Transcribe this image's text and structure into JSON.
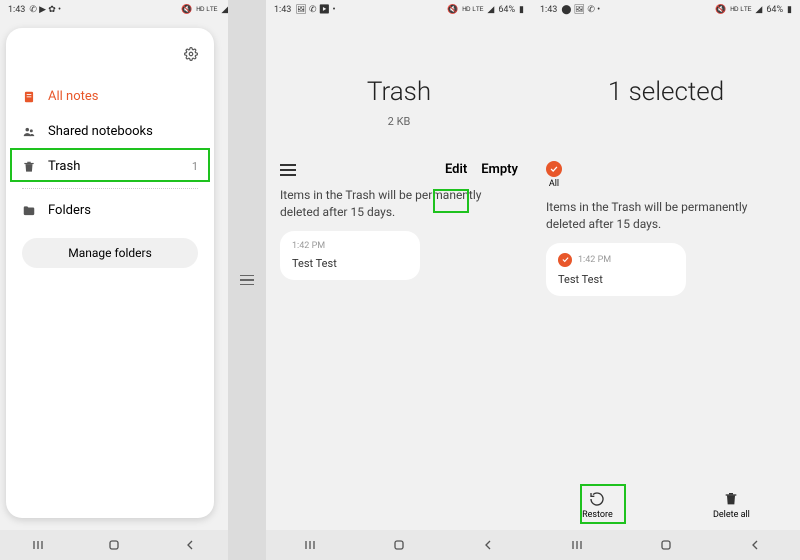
{
  "statusbar": {
    "time": "1:43",
    "battery": "64%",
    "net": "ᴴᴰ ᴸᵀᴱ"
  },
  "screen1": {
    "nav": {
      "allnotes": "All notes",
      "shared": "Shared notebooks",
      "trash": "Trash",
      "trash_count": "1",
      "folders": "Folders",
      "manage": "Manage folders"
    }
  },
  "screen2": {
    "title": "Trash",
    "size": "2 KB",
    "edit": "Edit",
    "empty": "Empty",
    "info": "Items in the Trash will be permanently deleted after 15 days.",
    "note": {
      "time": "1:42 PM",
      "title": "Test Test"
    }
  },
  "screen3": {
    "title": "1 selected",
    "all_label": "All",
    "info": "Items in the Trash will be permanently deleted after 15 days.",
    "note": {
      "time": "1:42 PM",
      "title": "Test Test"
    },
    "restore": "Restore",
    "deleteall": "Delete all"
  }
}
